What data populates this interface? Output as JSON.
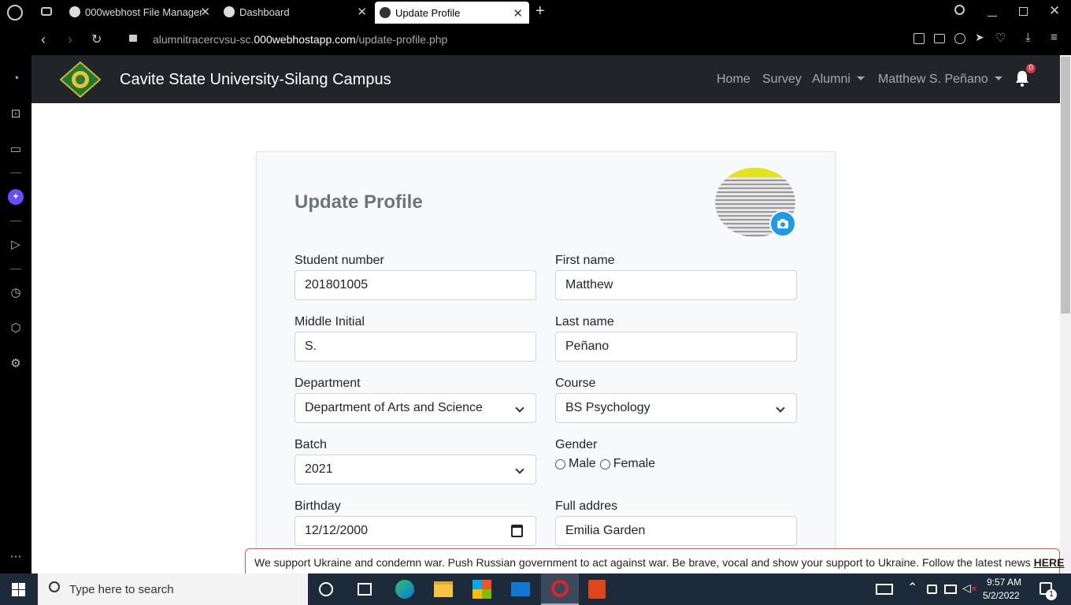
{
  "browser": {
    "tabs": [
      {
        "label": "000webhost File Manager"
      },
      {
        "label": "Dashboard"
      },
      {
        "label": "Update Profile"
      }
    ],
    "new_tab_label": "+",
    "url": {
      "prefix": "alumnitracercvsu-sc.",
      "domain": "000webhostapp.com",
      "path": "/update-profile.php"
    }
  },
  "navbar": {
    "brand": "Cavite State University-Silang Campus",
    "links": [
      "Home",
      "Survey"
    ],
    "alumni_label": "Alumni",
    "user_label": "Matthew S. Peñano",
    "notification_count": "0"
  },
  "form": {
    "title": "Update Profile",
    "student_number": {
      "label": "Student number",
      "value": "201801005"
    },
    "first_name": {
      "label": "First name",
      "value": "Matthew"
    },
    "middle_initial": {
      "label": "Middle Initial",
      "value": "S."
    },
    "last_name": {
      "label": "Last name",
      "value": "Peñano"
    },
    "department": {
      "label": "Department",
      "value": "Department of Arts and Science"
    },
    "course": {
      "label": "Course",
      "value": "BS Psychology"
    },
    "batch": {
      "label": "Batch",
      "value": "2021"
    },
    "gender": {
      "label": "Gender",
      "options": [
        "Male",
        "Female"
      ]
    },
    "birthday": {
      "label": "Birthday",
      "value": "12/12/2000"
    },
    "address": {
      "label": "Full addres",
      "value": "Emilia Garden"
    }
  },
  "banner": {
    "text": "We support Ukraine and condemn war. Push Russian government to act against war. Be brave, vocal and show your support to Ukraine. Follow the latest news ",
    "link": "HERE"
  },
  "taskbar": {
    "search_placeholder": "Type here to search",
    "time": "9:57 AM",
    "date": "5/2/2022",
    "notification_badge": "1"
  },
  "colors": {
    "navbar": "#212529",
    "accent": "#0d6efd",
    "banner_border": "#e05555"
  }
}
